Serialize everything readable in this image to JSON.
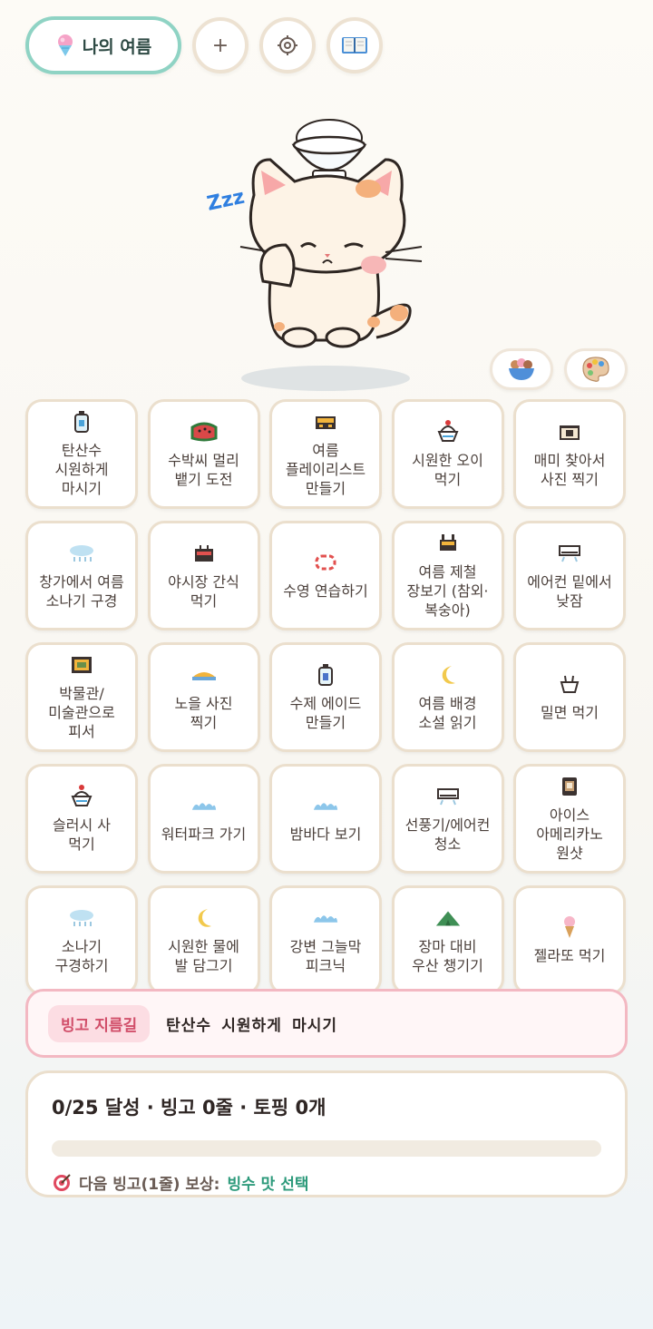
{
  "header": {
    "profile_label": "나의 여름",
    "profile_icon": "shaved-ice-icon",
    "add_label": "+",
    "settings_icon": "gear-icon",
    "book_icon": "book-icon"
  },
  "mascot": {
    "sleep_text": "Zzz"
  },
  "actions": {
    "bowl_icon": "bingsu-bowl-icon",
    "palette_icon": "palette-icon"
  },
  "grid": {
    "cells": [
      {
        "label": "탄산수\n시원하게\n마시기",
        "icon": "soda-bottle-icon"
      },
      {
        "label": "수박씨 멀리\n뱉기 도전",
        "icon": "watermelon-icon"
      },
      {
        "label": "여름\n플레이리스트\n만들기",
        "icon": "radio-icon"
      },
      {
        "label": "시원한 오이\n먹기",
        "icon": "shaved-ice-icon"
      },
      {
        "label": "매미 찾아서\n사진 찍기",
        "icon": "camera-icon"
      },
      {
        "label": "창가에서 여름\n소나기 구경",
        "icon": "rain-cloud-icon"
      },
      {
        "label": "야시장 간식\n먹기",
        "icon": "snack-icon"
      },
      {
        "label": "수영 연습하기",
        "icon": "swim-ring-icon"
      },
      {
        "label": "여름 제철\n장보기 (참외·\n복숭아)",
        "icon": "fruit-basket-icon"
      },
      {
        "label": "에어컨 밑에서\n낮잠",
        "icon": "air-conditioner-icon"
      },
      {
        "label": "박물관/\n미술관으로\n피서",
        "icon": "picture-frame-icon"
      },
      {
        "label": "노을 사진\n찍기",
        "icon": "sunset-icon"
      },
      {
        "label": "수제 에이드\n만들기",
        "icon": "ade-bottle-icon"
      },
      {
        "label": "여름 배경\n소설 읽기",
        "icon": "crescent-moon-icon"
      },
      {
        "label": "밀면 먹기",
        "icon": "noodle-bowl-icon"
      },
      {
        "label": "슬러시 사\n먹기",
        "icon": "slush-icon"
      },
      {
        "label": "워터파크 가기",
        "icon": "wave-icon"
      },
      {
        "label": "밤바다 보기",
        "icon": "wave-icon"
      },
      {
        "label": "선풍기/에어컨\n청소",
        "icon": "air-conditioner-icon"
      },
      {
        "label": "아이스\n아메리카노\n원샷",
        "icon": "iced-coffee-icon"
      },
      {
        "label": "소나기\n구경하기",
        "icon": "rain-cloud-icon"
      },
      {
        "label": "시원한 물에\n발 담그기",
        "icon": "crescent-moon-icon"
      },
      {
        "label": "강변 그늘막\n피크닉",
        "icon": "wave-icon"
      },
      {
        "label": "장마 대비\n우산 챙기기",
        "icon": "green-tent-icon"
      },
      {
        "label": "젤라또 먹기",
        "icon": "ice-cream-icon"
      }
    ]
  },
  "bingo_path": {
    "tag": "빙고 지름길",
    "text": "탄산수 시원하게 마시기"
  },
  "stats": {
    "summary": "0/25 달성 · 빙고 0줄 · 토핑 0개",
    "progress": 0,
    "reward_icon": "target-icon",
    "reward_label": "다음 빙고(1줄) 보상:",
    "reward_value": "빙수 맛 선택"
  },
  "colors": {
    "accent_mint": "#8fd3c4",
    "border_beige": "#ebdfcd",
    "pink": "#f3b8c2",
    "reward_green": "#2d9a7b"
  }
}
